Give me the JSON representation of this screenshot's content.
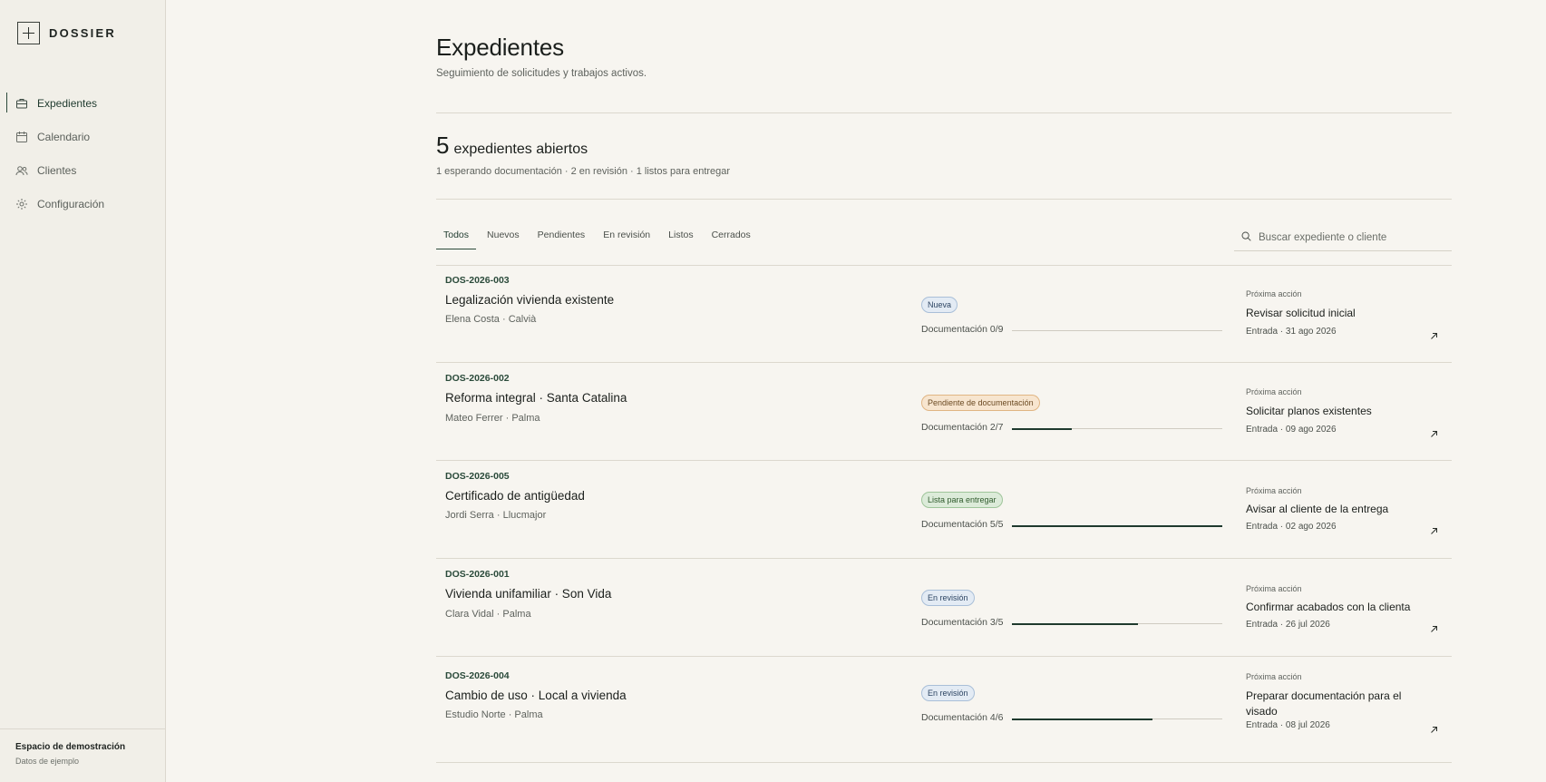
{
  "brand": {
    "name": "DOSSIER"
  },
  "sidebar": {
    "items": [
      {
        "label": "Expedientes",
        "icon": "briefcase-icon",
        "active": true
      },
      {
        "label": "Calendario",
        "icon": "calendar-icon",
        "active": false
      },
      {
        "label": "Clientes",
        "icon": "users-icon",
        "active": false
      },
      {
        "label": "Configuración",
        "icon": "gear-icon",
        "active": false
      }
    ],
    "footer": {
      "title": "Espacio de demostración",
      "subtitle": "Datos de ejemplo"
    }
  },
  "header": {
    "title": "Expedientes",
    "subtitle": "Seguimiento de solicitudes y trabajos activos."
  },
  "summary": {
    "count": "5",
    "count_label": "expedientes abiertos",
    "breakdown": "1 esperando documentación · 2 en revisión · 1 listos para entregar"
  },
  "tabs": [
    {
      "label": "Todos",
      "active": true
    },
    {
      "label": "Nuevos",
      "active": false
    },
    {
      "label": "Pendientes",
      "active": false
    },
    {
      "label": "En revisión",
      "active": false
    },
    {
      "label": "Listos",
      "active": false
    },
    {
      "label": "Cerrados",
      "active": false
    }
  ],
  "search": {
    "placeholder": "Buscar expediente o cliente"
  },
  "next_action_label": "Próxima acción",
  "colors": {
    "accent": "#1f3a2e",
    "badge_new_bg": "#e3ebf4",
    "badge_new_border": "#a9bfd8",
    "badge_pending_bg": "#f7e5cf",
    "badge_pending_border": "#e0b583",
    "badge_ready_bg": "#dcebd9",
    "badge_ready_border": "#9fc59a",
    "badge_review_bg": "#e3ebf4",
    "badge_review_border": "#a9bfd8"
  },
  "rows": [
    {
      "code": "DOS-2026-003",
      "title": "Legalización vivienda existente",
      "meta": "Elena Costa · Calvià",
      "status": "Nueva",
      "status_kind": "new",
      "docs": "Documentación 0/9",
      "progress": 0.0,
      "next": "Revisar solicitud inicial",
      "entry": "Entrada · 31 ago 2026"
    },
    {
      "code": "DOS-2026-002",
      "title": "Reforma integral · Santa Catalina",
      "meta": "Mateo Ferrer · Palma",
      "status": "Pendiente de documentación",
      "status_kind": "pending",
      "docs": "Documentación 2/7",
      "progress": 0.2857,
      "next": "Solicitar planos existentes",
      "entry": "Entrada · 09 ago 2026"
    },
    {
      "code": "DOS-2026-005",
      "title": "Certificado de antigüedad",
      "meta": "Jordi Serra · Llucmajor",
      "status": "Lista para entregar",
      "status_kind": "ready",
      "docs": "Documentación 5/5",
      "progress": 1.0,
      "next": "Avisar al cliente de la entrega",
      "entry": "Entrada · 02 ago 2026"
    },
    {
      "code": "DOS-2026-001",
      "title": "Vivienda unifamiliar · Son Vida",
      "meta": "Clara Vidal · Palma",
      "status": "En revisión",
      "status_kind": "review",
      "docs": "Documentación 3/5",
      "progress": 0.6,
      "next": "Confirmar acabados con la clienta",
      "entry": "Entrada · 26 jul 2026"
    },
    {
      "code": "DOS-2026-004",
      "title": "Cambio de uso · Local a vivienda",
      "meta": "Estudio Norte · Palma",
      "status": "En revisión",
      "status_kind": "review",
      "docs": "Documentación 4/6",
      "progress": 0.6667,
      "next": "Preparar documentación para el visado",
      "entry": "Entrada · 08 jul 2026"
    }
  ]
}
